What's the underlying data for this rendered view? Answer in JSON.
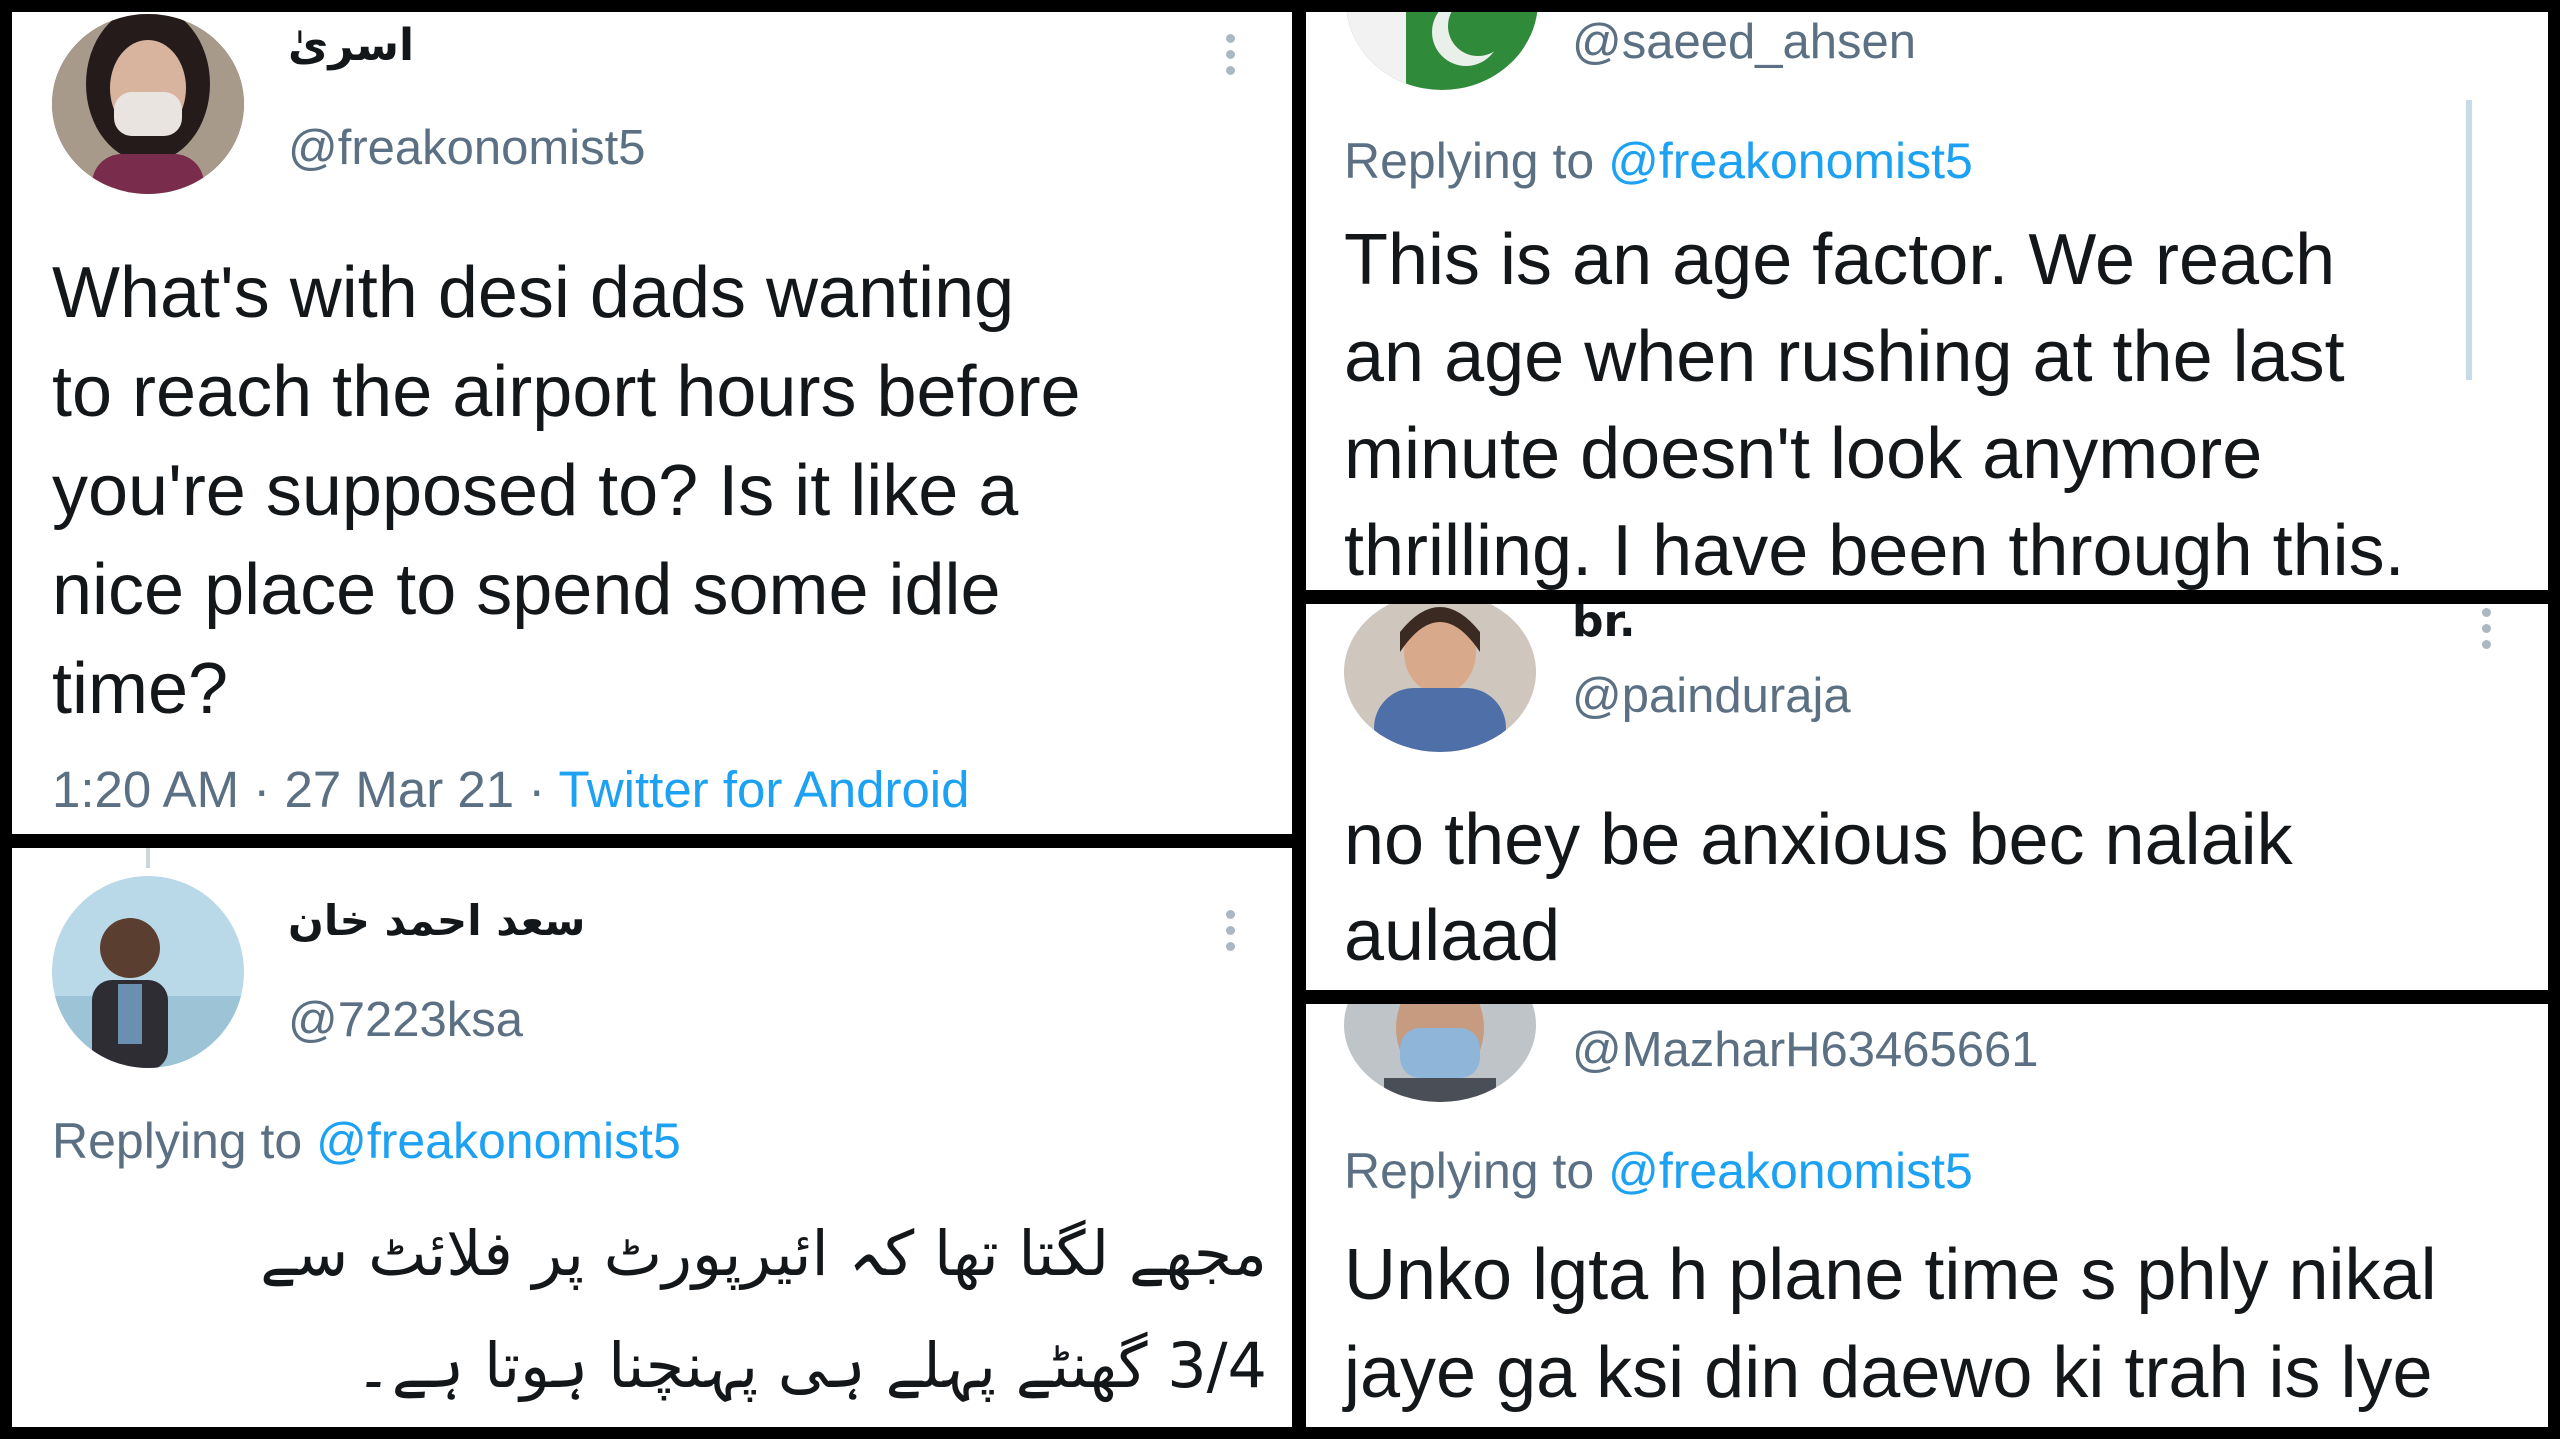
{
  "tweet_main": {
    "display_name": "اسریٰ",
    "handle": "@freakonomist5",
    "text_lines": [
      "What's with desi dads wanting",
      "to reach the airport hours before",
      "you're supposed to? Is it like a",
      "nice place to spend some idle",
      "time?"
    ],
    "time": "1:20 AM",
    "date": "27 Mar 21",
    "source": "Twitter for Android"
  },
  "reply_urdu": {
    "display_name": "سعد احمد خان",
    "handle": "@7223ksa",
    "replying_prefix": "Replying to",
    "replying_to": "@freakonomist5",
    "text_lines": [
      "مجھے لگتا تھا کہ ائیرپورٹ پر فلائٹ سے",
      "3/4 گھنٹے پہلے ہی پہنچنا ہوتا ہے۔"
    ]
  },
  "reply_saeed": {
    "handle": "@saeed_ahsen",
    "replying_prefix": "Replying to",
    "replying_to": "@freakonomist5",
    "text_lines": [
      "This is an age factor. We reach",
      "an age when rushing at the last",
      "minute doesn't look anymore",
      "thrilling. I have been through this."
    ]
  },
  "reply_painduraja": {
    "display_name": "br.",
    "handle": "@painduraja",
    "text_lines": [
      "no they be anxious bec nalaik",
      "aulaad"
    ]
  },
  "reply_mazhar": {
    "handle": "@MazharH63465661",
    "replying_prefix": "Replying to",
    "replying_to": "@freakonomist5",
    "text_lines": [
      "Unko lgta h plane time s phly nikal",
      "jaye ga ksi din daewo ki trah is lye"
    ]
  },
  "colors": {
    "link": "#1da1f2",
    "secondary_text": "#5b7083",
    "primary_text": "#14171a",
    "divider": "#000000"
  },
  "icons": {
    "more": "vertical-ellipsis-icon",
    "avatar": "profile-photo"
  }
}
